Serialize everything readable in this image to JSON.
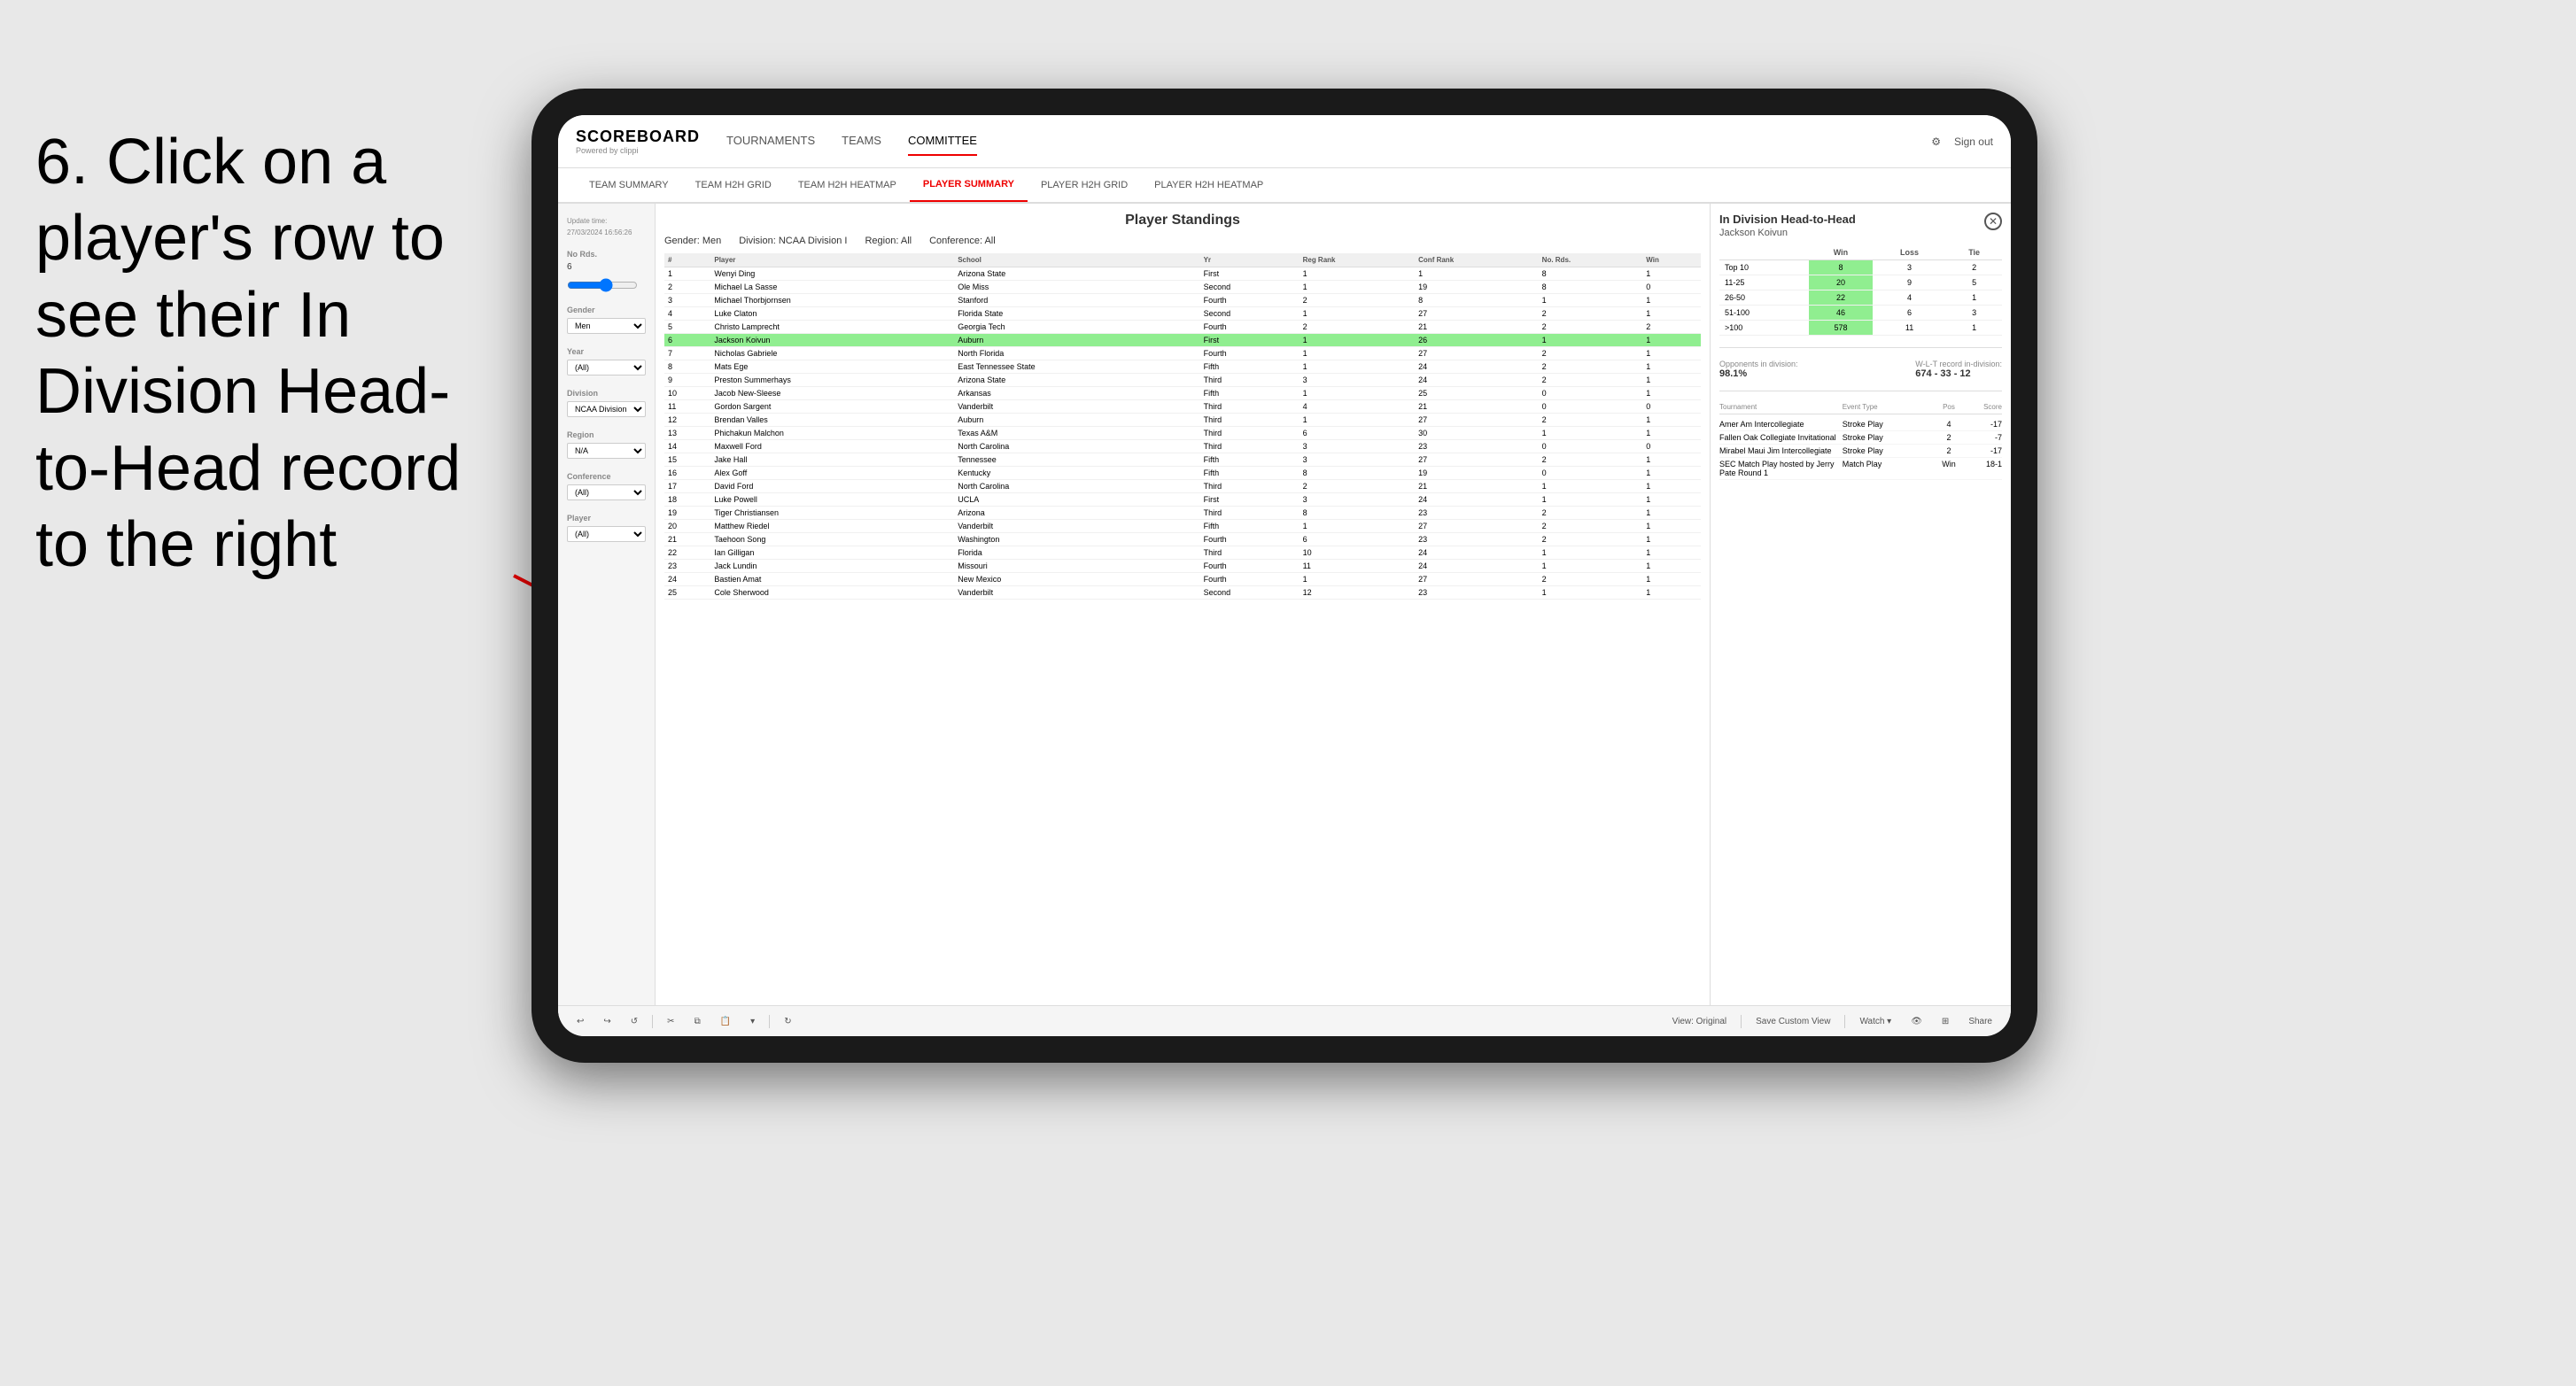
{
  "instruction": {
    "text": "6. Click on a player's row to see their In Division Head-to-Head record to the right"
  },
  "nav": {
    "logo": "SCOREBOARD",
    "powered_by": "Powered by clippi",
    "items": [
      "TOURNAMENTS",
      "TEAMS",
      "COMMITTEE"
    ],
    "sign_out": "Sign out"
  },
  "sub_nav": {
    "items": [
      "TEAM SUMMARY",
      "TEAM H2H GRID",
      "TEAM H2H HEATMAP",
      "PLAYER SUMMARY",
      "PLAYER H2H GRID",
      "PLAYER H2H HEATMAP"
    ],
    "active": "PLAYER SUMMARY"
  },
  "sidebar": {
    "update_label": "Update time:",
    "update_time": "27/03/2024 16:56:26",
    "no_rds_label": "No Rds.",
    "no_rds_value": "6",
    "gender_label": "Gender",
    "gender_value": "Men",
    "year_label": "Year",
    "year_value": "(All)",
    "division_label": "Division",
    "division_value": "NCAA Division I",
    "region_label": "Region",
    "region_value": "N/A",
    "conference_label": "Conference",
    "conference_value": "(All)",
    "player_label": "Player",
    "player_value": "(All)"
  },
  "table": {
    "title": "Player Standings",
    "filters": {
      "gender": "Men",
      "division": "NCAA Division I",
      "region": "All",
      "conference": "All"
    },
    "columns": [
      "#",
      "Player",
      "School",
      "Yr",
      "Reg Rank",
      "Conf Rank",
      "No. Rds.",
      "Win"
    ],
    "rows": [
      {
        "rank": 1,
        "player": "Wenyi Ding",
        "school": "Arizona State",
        "yr": "First",
        "reg": 1,
        "conf": 1,
        "rds": 8,
        "win": 1
      },
      {
        "rank": 2,
        "player": "Michael La Sasse",
        "school": "Ole Miss",
        "yr": "Second",
        "reg": 1,
        "conf": 19,
        "rds": 8,
        "win": 0
      },
      {
        "rank": 3,
        "player": "Michael Thorbjornsen",
        "school": "Stanford",
        "yr": "Fourth",
        "reg": 2,
        "conf": 8,
        "rds": 1,
        "win": 1
      },
      {
        "rank": 4,
        "player": "Luke Claton",
        "school": "Florida State",
        "yr": "Second",
        "reg": 1,
        "conf": 27,
        "rds": 2,
        "win": 1
      },
      {
        "rank": 5,
        "player": "Christo Lamprecht",
        "school": "Georgia Tech",
        "yr": "Fourth",
        "reg": 2,
        "conf": 21,
        "rds": 2,
        "win": 2
      },
      {
        "rank": 6,
        "player": "Jackson Koivun",
        "school": "Auburn",
        "yr": "First",
        "reg": 1,
        "conf": 26,
        "rds": 1,
        "win": 1,
        "highlighted": true
      },
      {
        "rank": 7,
        "player": "Nicholas Gabriele",
        "school": "North Florida",
        "yr": "Fourth",
        "reg": 1,
        "conf": 27,
        "rds": 2,
        "win": 1
      },
      {
        "rank": 8,
        "player": "Mats Ege",
        "school": "East Tennessee State",
        "yr": "Fifth",
        "reg": 1,
        "conf": 24,
        "rds": 2,
        "win": 1
      },
      {
        "rank": 9,
        "player": "Preston Summerhays",
        "school": "Arizona State",
        "yr": "Third",
        "reg": 3,
        "conf": 24,
        "rds": 2,
        "win": 1
      },
      {
        "rank": 10,
        "player": "Jacob New-Sleese",
        "school": "Arkansas",
        "yr": "Fifth",
        "reg": 1,
        "conf": 25,
        "rds": 0,
        "win": 1
      },
      {
        "rank": 11,
        "player": "Gordon Sargent",
        "school": "Vanderbilt",
        "yr": "Third",
        "reg": 4,
        "conf": 21,
        "rds": 0,
        "win": 0
      },
      {
        "rank": 12,
        "player": "Brendan Valles",
        "school": "Auburn",
        "yr": "Third",
        "reg": 1,
        "conf": 27,
        "rds": 2,
        "win": 1
      },
      {
        "rank": 13,
        "player": "Phichakun Malchon",
        "school": "Texas A&M",
        "yr": "Third",
        "reg": 6,
        "conf": 30,
        "rds": 1,
        "win": 1
      },
      {
        "rank": 14,
        "player": "Maxwell Ford",
        "school": "North Carolina",
        "yr": "Third",
        "reg": 3,
        "conf": 23,
        "rds": 0,
        "win": 0
      },
      {
        "rank": 15,
        "player": "Jake Hall",
        "school": "Tennessee",
        "yr": "Fifth",
        "reg": 3,
        "conf": 27,
        "rds": 2,
        "win": 1
      },
      {
        "rank": 16,
        "player": "Alex Goff",
        "school": "Kentucky",
        "yr": "Fifth",
        "reg": 8,
        "conf": 19,
        "rds": 0,
        "win": 1
      },
      {
        "rank": 17,
        "player": "David Ford",
        "school": "North Carolina",
        "yr": "Third",
        "reg": 2,
        "conf": 21,
        "rds": 1,
        "win": 1
      },
      {
        "rank": 18,
        "player": "Luke Powell",
        "school": "UCLA",
        "yr": "First",
        "reg": 3,
        "conf": 24,
        "rds": 1,
        "win": 1
      },
      {
        "rank": 19,
        "player": "Tiger Christiansen",
        "school": "Arizona",
        "yr": "Third",
        "reg": 8,
        "conf": 23,
        "rds": 2,
        "win": 1
      },
      {
        "rank": 20,
        "player": "Matthew Riedel",
        "school": "Vanderbilt",
        "yr": "Fifth",
        "reg": 1,
        "conf": 27,
        "rds": 2,
        "win": 1
      },
      {
        "rank": 21,
        "player": "Taehoon Song",
        "school": "Washington",
        "yr": "Fourth",
        "reg": 6,
        "conf": 23,
        "rds": 2,
        "win": 1
      },
      {
        "rank": 22,
        "player": "Ian Gilligan",
        "school": "Florida",
        "yr": "Third",
        "reg": 10,
        "conf": 24,
        "rds": 1,
        "win": 1
      },
      {
        "rank": 23,
        "player": "Jack Lundin",
        "school": "Missouri",
        "yr": "Fourth",
        "reg": 11,
        "conf": 24,
        "rds": 1,
        "win": 1
      },
      {
        "rank": 24,
        "player": "Bastien Amat",
        "school": "New Mexico",
        "yr": "Fourth",
        "reg": 1,
        "conf": 27,
        "rds": 2,
        "win": 1
      },
      {
        "rank": 25,
        "player": "Cole Sherwood",
        "school": "Vanderbilt",
        "yr": "Second",
        "reg": 12,
        "conf": 23,
        "rds": 1,
        "win": 1
      }
    ]
  },
  "h2h": {
    "title": "In Division Head-to-Head",
    "player_name": "Jackson Koivun",
    "columns": [
      "",
      "Win",
      "Loss",
      "Tie"
    ],
    "rows": [
      {
        "label": "Top 10",
        "win": 8,
        "loss": 3,
        "tie": 2,
        "win_highlighted": true
      },
      {
        "label": "11-25",
        "win": 20,
        "loss": 9,
        "tie": 5,
        "win_highlighted": true
      },
      {
        "label": "26-50",
        "win": 22,
        "loss": 4,
        "tie": 1,
        "win_highlighted": true
      },
      {
        "label": "51-100",
        "win": 46,
        "loss": 6,
        "tie": 3,
        "win_highlighted": true
      },
      {
        "label": ">100",
        "win": 578,
        "loss": 11,
        "tie": 1,
        "win_highlighted": true
      }
    ],
    "opponents_label": "Opponents in division:",
    "opponents_value": "98.1%",
    "record_label": "W-L-T record in-division:",
    "record_value": "674 - 33 - 12",
    "tournament_columns": [
      "Tournament",
      "Event Type",
      "Pos",
      "Score"
    ],
    "tournaments": [
      {
        "name": "Amer Am Intercollegiate",
        "type": "Stroke Play",
        "pos": 4,
        "score": "-17"
      },
      {
        "name": "Fallen Oak Collegiate Invitational",
        "type": "Stroke Play",
        "pos": 2,
        "score": "-7"
      },
      {
        "name": "Mirabel Maui Jim Intercollegiate",
        "type": "Stroke Play",
        "pos": 2,
        "score": "-17"
      },
      {
        "name": "SEC Match Play hosted by Jerry Pate Round 1",
        "type": "Match Play",
        "pos": "Win",
        "score": "18-1"
      }
    ]
  },
  "toolbar": {
    "view_original": "View: Original",
    "save_custom": "Save Custom View",
    "watch": "Watch ▾",
    "share": "Share"
  }
}
